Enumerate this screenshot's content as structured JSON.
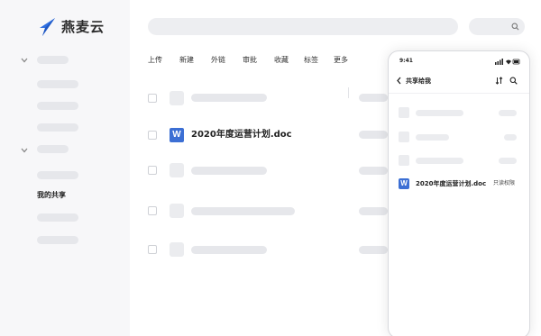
{
  "brand": {
    "name": "燕麦云",
    "color": "#2f6fe0"
  },
  "sidebar": {
    "active_label": "我的共享"
  },
  "toolbar": {
    "items": [
      "上传",
      "新建",
      "外链",
      "审批",
      "收藏",
      "标签",
      "更多"
    ]
  },
  "file_list": {
    "highlight_icon": "W",
    "highlight_name": "2020年度运营计划.doc"
  },
  "phone": {
    "time": "9:41",
    "title": "共享给我",
    "file_icon": "W",
    "file_name": "2020年度运营计划.doc",
    "permission": "只读权限"
  },
  "colors": {
    "accent": "#3c6fd4",
    "placeholder": "#e6e7eb",
    "sidebar_bg": "#f7f7f9"
  },
  "icons": [
    "logo-icon",
    "chevron-down-icon",
    "search-icon",
    "word-doc-icon",
    "back-icon",
    "sort-icon"
  ]
}
